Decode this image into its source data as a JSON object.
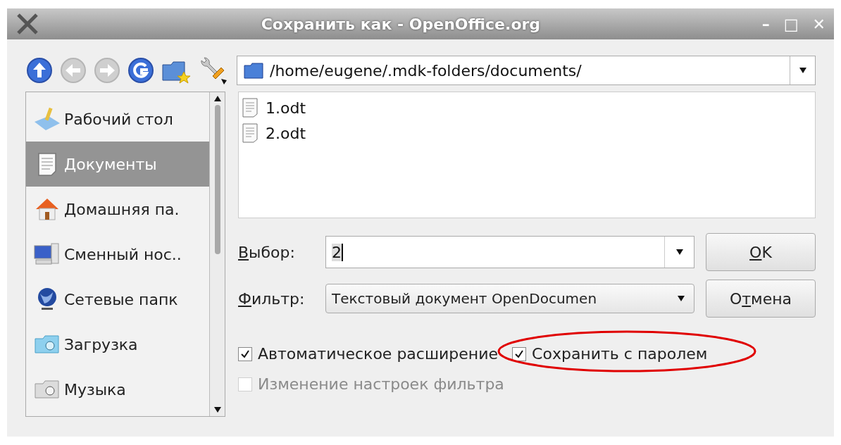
{
  "window": {
    "title": "Сохранить как - OpenOffice.org",
    "controls": [
      "–",
      "□",
      "✕"
    ]
  },
  "toolbar": {
    "path": "/home/eugene/.mdk-folders/documents/",
    "buttons": [
      {
        "kind": "up",
        "disabled": false
      },
      {
        "kind": "back",
        "disabled": true
      },
      {
        "kind": "forward",
        "disabled": true
      },
      {
        "kind": "refresh",
        "disabled": false
      },
      {
        "kind": "newfolder",
        "disabled": false
      },
      {
        "kind": "tools",
        "disabled": false
      }
    ]
  },
  "sidebar": {
    "items": [
      {
        "label": "Рабочий стол",
        "kind": "desktop",
        "selected": false
      },
      {
        "label": "Документы",
        "kind": "documents",
        "selected": true
      },
      {
        "label": "Домашняя па.",
        "kind": "home",
        "selected": false
      },
      {
        "label": "Сменный нос..",
        "kind": "removable",
        "selected": false
      },
      {
        "label": "Сетевые папк",
        "kind": "network",
        "selected": false
      },
      {
        "label": "Загрузка",
        "kind": "download",
        "selected": false
      },
      {
        "label": "Музыка",
        "kind": "music",
        "selected": false
      }
    ]
  },
  "files": [
    {
      "name": "1.odt"
    },
    {
      "name": "2.odt"
    }
  ],
  "selection": {
    "label": {
      "key": "В",
      "after": "ыбор:"
    },
    "value": "2"
  },
  "filter": {
    "label": {
      "key": "Ф",
      "after": "ильтр:"
    },
    "value": "Текстовый документ OpenDocumen"
  },
  "buttons": [
    {
      "key": "O",
      "after": "K"
    },
    {
      "before": "О",
      "key": "т",
      "after": "мена"
    }
  ],
  "options": [
    {
      "label": "Автоматическое расширение",
      "checked": true,
      "disabled": false
    },
    {
      "label": "Сохранить с паролем",
      "checked": true,
      "disabled": false
    },
    {
      "label": "Изменение настроек фильтра",
      "checked": false,
      "disabled": true
    }
  ]
}
